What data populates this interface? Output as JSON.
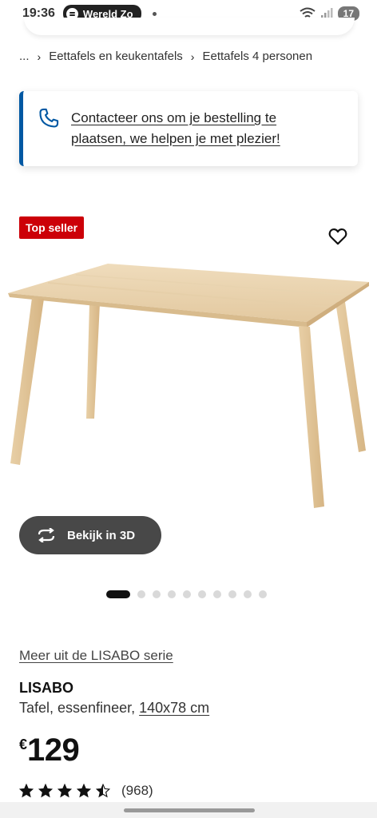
{
  "status_bar": {
    "time": "19:36",
    "media_label": "Wereld Zo",
    "battery": "17"
  },
  "breadcrumb": {
    "ellipsis": "...",
    "items": [
      "Eettafels en keukentafels",
      "Eettafels 4 personen"
    ]
  },
  "contact": {
    "text": "Contacteer ons om je bestelling te plaatsen, we helpen je met plezier!",
    "accent": "#0058a3"
  },
  "badge": {
    "label": "Top seller",
    "color": "#cc0008"
  },
  "gallery": {
    "view3d_label": "Bekijk in 3D",
    "total_images": 10,
    "active_index": 0
  },
  "product": {
    "series_link": "Meer uit de LISABO serie",
    "name": "LISABO",
    "description": "Tafel, essenfineer,",
    "dimensions": "140x78 cm",
    "currency": "€",
    "price": "129",
    "rating": 4.5,
    "review_count": "(968)"
  }
}
